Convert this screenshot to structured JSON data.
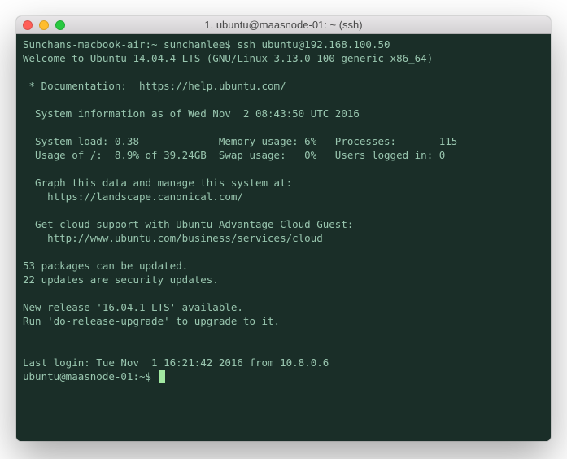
{
  "window": {
    "title": "1. ubuntu@maasnode-01: ~ (ssh)"
  },
  "terminal": {
    "line_ssh": "Sunchans-macbook-air:~ sunchanlee$ ssh ubuntu@192.168.100.50",
    "line_welcome": "Welcome to Ubuntu 14.04.4 LTS (GNU/Linux 3.13.0-100-generic x86_64)",
    "line_blank1": "",
    "line_doc": " * Documentation:  https://help.ubuntu.com/",
    "line_blank2": "",
    "line_sysinfo_hdr": "  System information as of Wed Nov  2 08:43:50 UTC 2016",
    "line_blank3": "",
    "line_stats1": "  System load: 0.38             Memory usage: 6%   Processes:       115",
    "line_stats2": "  Usage of /:  8.9% of 39.24GB  Swap usage:   0%   Users logged in: 0",
    "line_blank4": "",
    "line_graph1": "  Graph this data and manage this system at:",
    "line_graph2": "    https://landscape.canonical.com/",
    "line_blank5": "",
    "line_cloud1": "  Get cloud support with Ubuntu Advantage Cloud Guest:",
    "line_cloud2": "    http://www.ubuntu.com/business/services/cloud",
    "line_blank6": "",
    "line_pkg1": "53 packages can be updated.",
    "line_pkg2": "22 updates are security updates.",
    "line_blank7": "",
    "line_release1": "New release '16.04.1 LTS' available.",
    "line_release2": "Run 'do-release-upgrade' to upgrade to it.",
    "line_blank8": "",
    "line_blank9": "",
    "line_lastlogin": "Last login: Tue Nov  1 16:21:42 2016 from 10.8.0.6",
    "prompt": "ubuntu@maasnode-01:~$ "
  }
}
